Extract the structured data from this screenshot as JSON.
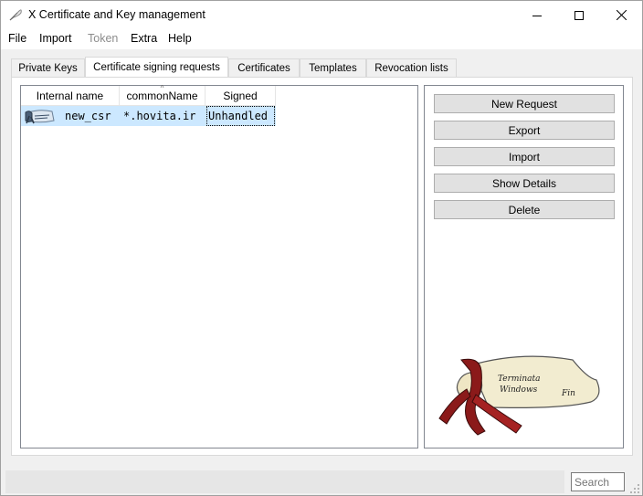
{
  "window": {
    "title": "X Certificate and Key management",
    "controls": {
      "minimize": "minimize-icon",
      "maximize": "maximize-icon",
      "close": "close-icon"
    }
  },
  "menu": {
    "items": [
      {
        "label": "File",
        "enabled": true
      },
      {
        "label": "Import",
        "enabled": true
      },
      {
        "label": "Token",
        "enabled": false
      },
      {
        "label": "Extra",
        "enabled": true
      },
      {
        "label": "Help",
        "enabled": true
      }
    ]
  },
  "tabs": [
    {
      "label": "Private Keys",
      "active": false
    },
    {
      "label": "Certificate signing requests",
      "active": true
    },
    {
      "label": "Certificates",
      "active": false
    },
    {
      "label": "Templates",
      "active": false
    },
    {
      "label": "Revocation lists",
      "active": false
    }
  ],
  "table": {
    "columns": [
      "Internal name",
      "commonName",
      "Signed"
    ],
    "sorted_column": "commonName",
    "rows": [
      {
        "icon": "csr-scroll-icon",
        "internal_name": "new_csr",
        "common_name": "*.hovita.ir",
        "signed": "Unhandled",
        "selected": true
      }
    ]
  },
  "actions": {
    "new_request": "New Request",
    "export": "Export",
    "import": "Import",
    "show_details": "Show Details",
    "delete": "Delete"
  },
  "logo": {
    "icon": "xca-scroll-logo",
    "text_line1": "Terminata",
    "text_line2": "Windows",
    "text_line3": "Fin"
  },
  "statusbar": {
    "search_placeholder": "Search"
  },
  "colors": {
    "selection": "#cce8ff",
    "window_bg": "#f0f0f0",
    "button_bg": "#e1e1e1",
    "ribbon_red": "#8b1a1a",
    "parchment": "#f2ecd0"
  }
}
